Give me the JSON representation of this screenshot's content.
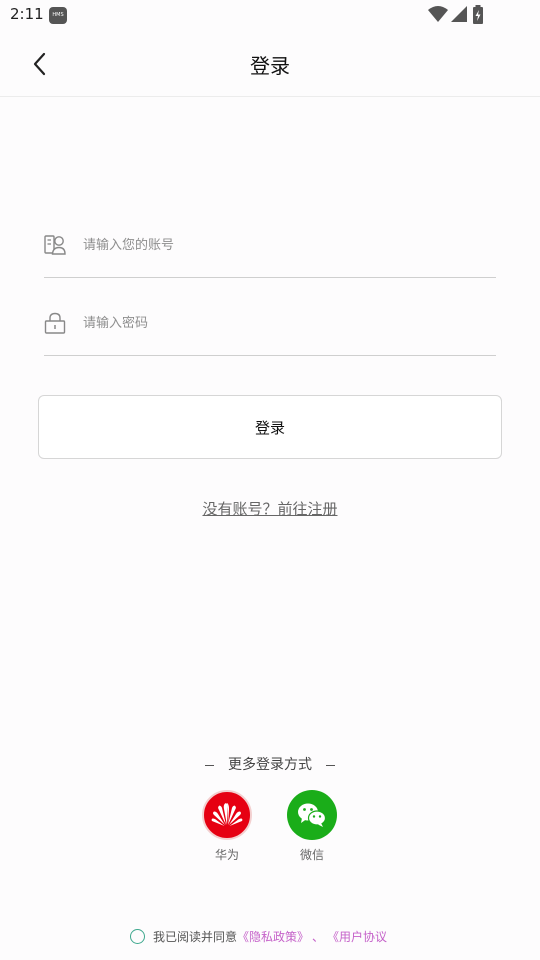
{
  "status_bar": {
    "time": "2:11",
    "hms_badge": "HMS",
    "icons": [
      "wifi-icon",
      "cell-signal-icon",
      "battery-charging-icon"
    ]
  },
  "header": {
    "title": "登录",
    "back_icon": "chevron-left-icon"
  },
  "form": {
    "account": {
      "placeholder": "请输入您的账号",
      "value": "",
      "icon": "account-icon"
    },
    "password": {
      "placeholder": "请输入密码",
      "value": "",
      "icon": "lock-icon"
    },
    "login_label": "登录",
    "register_link": "没有账号？前往注册"
  },
  "more_login": {
    "title": "更多登录方式",
    "options": [
      {
        "label": "华为",
        "icon": "huawei-logo-icon",
        "color": "#e60012"
      },
      {
        "label": "微信",
        "icon": "wechat-logo-icon",
        "color": "#1aad19"
      }
    ]
  },
  "agreement": {
    "prefix": "我已阅读并同意",
    "privacy": "《隐私政策》",
    "separator": "、",
    "user_agreement": "《用户协议"
  },
  "colors": {
    "link": "#c561c9",
    "radio": "#3fa88e"
  }
}
